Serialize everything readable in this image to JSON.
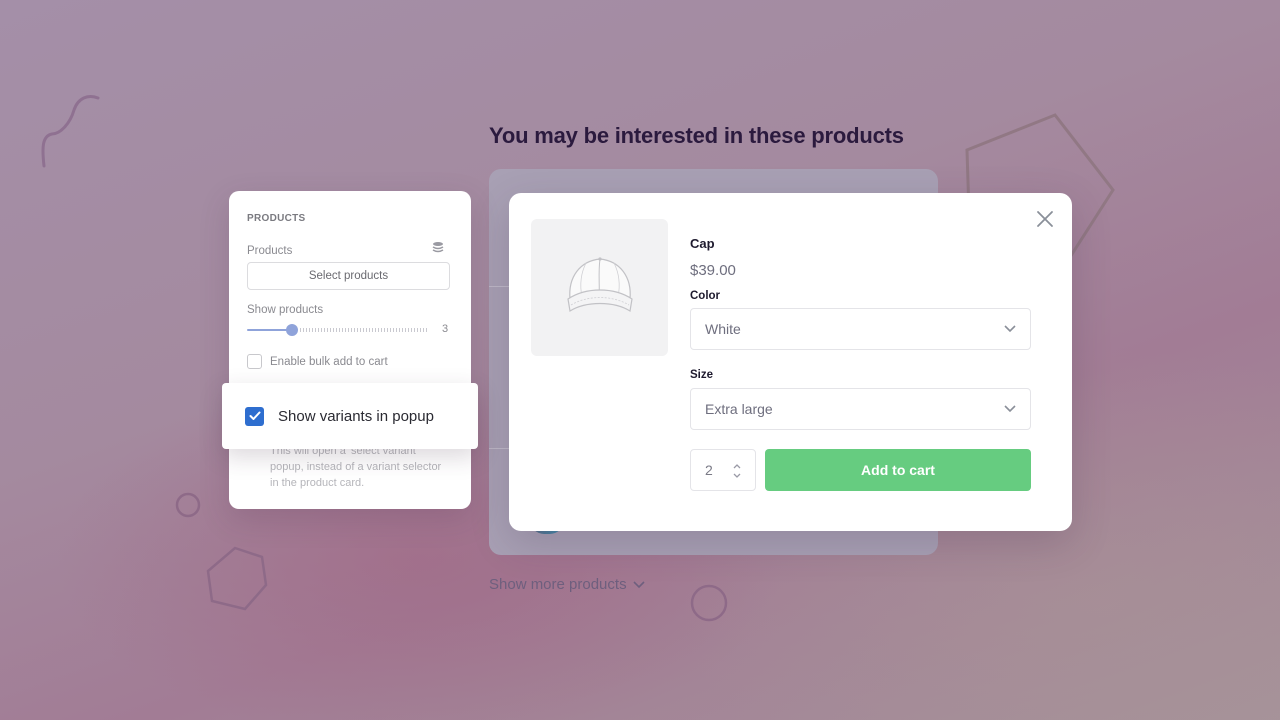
{
  "heading": "You may be interested in these products",
  "show_more": "Show more products",
  "settings": {
    "section_title": "PRODUCTS",
    "products_label": "Products",
    "select_products_button": "Select products",
    "show_products_label": "Show products",
    "show_products_value": "3",
    "show_products_slider_fraction": 0.25,
    "bulk_add_label": "Enable bulk add to cart",
    "bulk_add_checked": false,
    "variants_popup_label": "Show variants in popup",
    "variants_popup_checked": true,
    "variants_popup_help": "This will open a 'select variant' popup, instead of a variant selector in the product card."
  },
  "modal": {
    "product_name": "Cap",
    "price": "$39.00",
    "color_label": "Color",
    "color_value": "White",
    "size_label": "Size",
    "size_value": "Extra large",
    "quantity": "2",
    "add_to_cart": "Add to cart"
  },
  "colors": {
    "accent_blue": "#2e6ecf",
    "add_to_cart_green": "#66cc80",
    "slider": "#8fa3da",
    "heading": "#2b1a3e"
  }
}
